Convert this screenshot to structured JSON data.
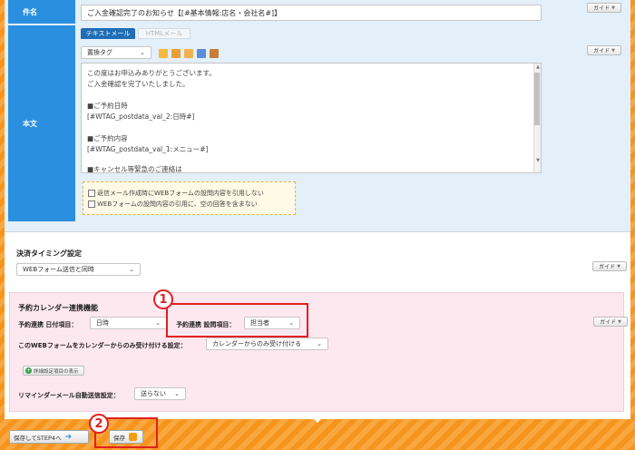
{
  "mail": {
    "subject_label": "件名",
    "subject_value": "ご入金確認完了のお知らせ【[#基本情報:店名・会社名#]】",
    "body_label": "本文",
    "tab_text": "テキストメール",
    "tab_html": "HTMLメール",
    "replace_tag": "置換タグ",
    "guide_label": "ガイド",
    "body_lines": [
      "この度はお申込みありがとうございます。",
      "ご入金確認を完了いたしました。",
      "",
      "■ご予約日時",
      "[#WTAG_postdata_val_2:日時#]",
      "",
      "■ご予約内容",
      "[#WTAG_postdata_val_1:メニュー#]",
      "",
      "■キャンセル等緊急のご連絡は"
    ],
    "option_1": "返信メール作成時にWEBフォームの設問内容を引用しない",
    "option_2": "WEBフォームの設問内容の引用に、空の回答を含まない"
  },
  "payment": {
    "title": "決済タイミング設定",
    "value": "WEBフォーム送信と同時",
    "guide_label": "ガイド"
  },
  "calendar": {
    "title": "予約カレンダー連携機能",
    "date_label": "予約連携 日付項目：",
    "date_value": "日時",
    "item_label": "予約連携 設問項目：",
    "item_value": "担当者",
    "only_label": "このWEBフォームをカレンダーからのみ受け付ける設定：",
    "only_value": "カレンダーからのみ受け付ける",
    "detail_btn": "詳細設定項目の表示",
    "reminder_label": "リマインダーメール自動送信設定：",
    "reminder_value": "送らない",
    "guide_label": "ガイド"
  },
  "annotations": {
    "badge_1": "1",
    "badge_2": "2"
  },
  "footer": {
    "save_next": "保存してSTEP4へ",
    "save": "保存"
  },
  "colors": {
    "label_blue": "#2b8fe0",
    "tab_active": "#1f6db5",
    "highlight_red": "#e02020",
    "orange_bg": "#f7941d",
    "pink_bg": "#fde8ef"
  }
}
